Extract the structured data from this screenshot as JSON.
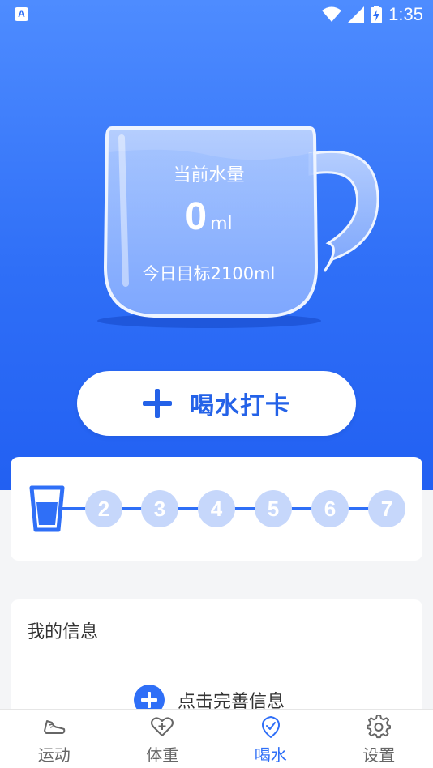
{
  "status_bar": {
    "time": "1:35",
    "app_badge": "A"
  },
  "cup": {
    "label": "当前水量",
    "value": "0",
    "unit": "ml",
    "goal": "今日目标2100ml"
  },
  "checkin_button": {
    "label": "喝水打卡"
  },
  "progress": {
    "current": 1,
    "total": 7,
    "steps": [
      "2",
      "3",
      "4",
      "5",
      "6",
      "7"
    ]
  },
  "my_info": {
    "title": "我的信息",
    "action_label": "点击完善信息"
  },
  "tabs": [
    {
      "label": "运动",
      "icon": "shoe-icon",
      "active": false
    },
    {
      "label": "体重",
      "icon": "heart-plus-icon",
      "active": false
    },
    {
      "label": "喝水",
      "icon": "water-drop-check-icon",
      "active": true
    },
    {
      "label": "设置",
      "icon": "gear-icon",
      "active": false
    }
  ],
  "colors": {
    "accent": "#2f6ff7",
    "step_inactive": "#c6d7fb",
    "tab_inactive": "#666666"
  }
}
